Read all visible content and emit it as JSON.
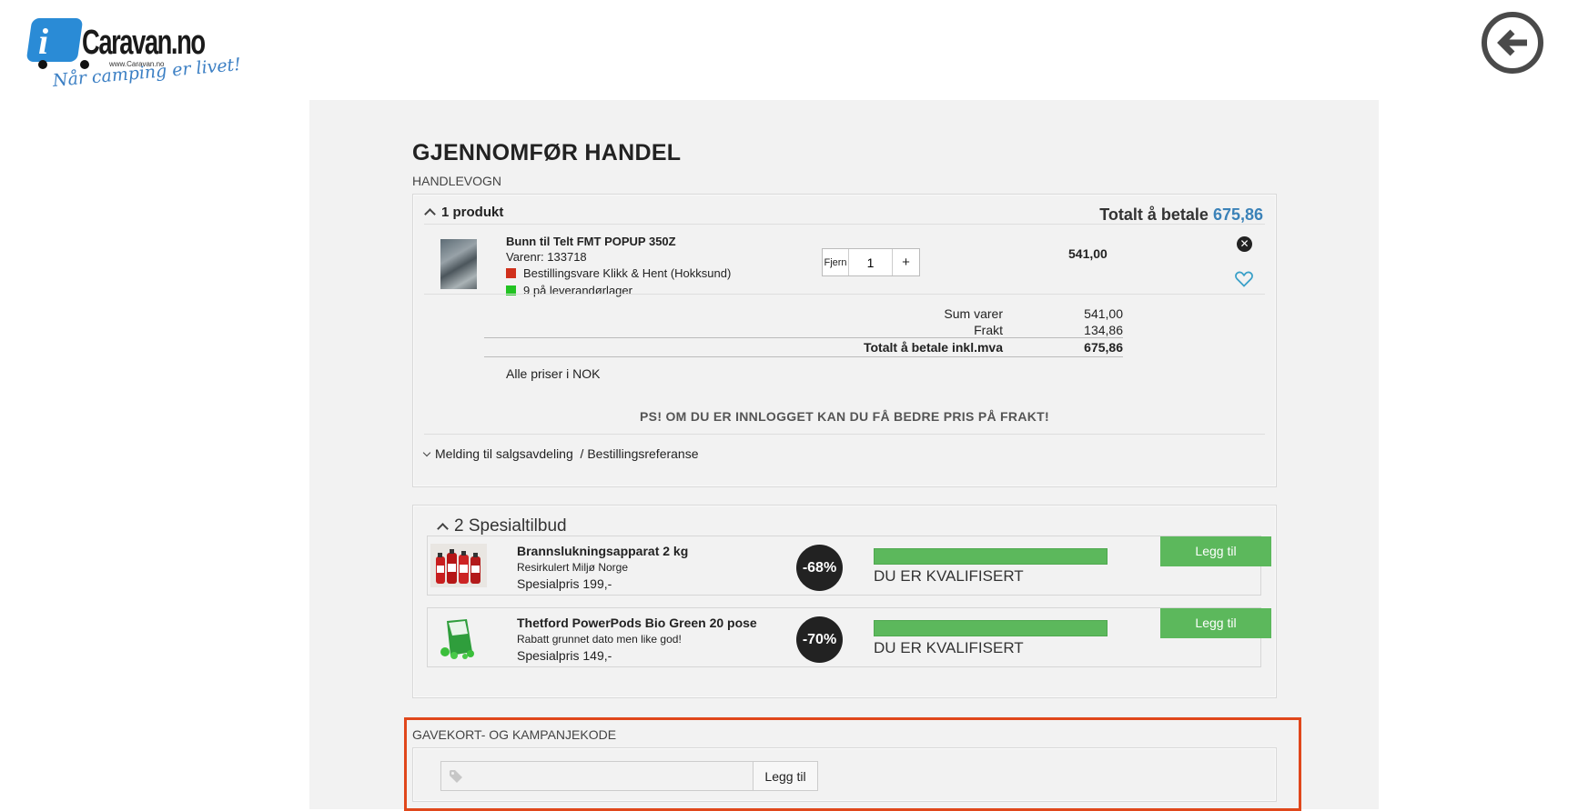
{
  "logo": {
    "brand": "Caravan.no",
    "url": "www.Caravan.no",
    "slogan": "Når camping er livet!",
    "letter": "i"
  },
  "page": {
    "title": "GJENNOMFØR HANDEL",
    "cart_label": "HANDLEVOGN",
    "currency_note": "Alle priser i NOK",
    "freight_note": "PS! OM DU ER INNLOGGET KAN DU FÅ BEDRE PRIS PÅ FRAKT!",
    "message_link_a": "Melding til salgsavdeling",
    "message_link_b": "/ Bestillingsreferanse"
  },
  "cart": {
    "count_label": "1 produkt",
    "total_label": "Totalt å betale",
    "total_value": "675,86",
    "items": [
      {
        "name": "Bunn til Telt FMT POPUP 350Z",
        "sku": "Varenr: 133718",
        "stock1": "Bestillingsvare Klikk & Hent (Hokksund)",
        "stock1_color": "#d0301c",
        "stock2": "9 på leverandørlager",
        "stock2_color": "#22c322",
        "remove_label": "Fjern",
        "quantity": "1",
        "plus_label": "+",
        "price": "541,00"
      }
    ],
    "summary": [
      {
        "label": "Sum varer",
        "value": "541,00"
      },
      {
        "label": "Frakt",
        "value": "134,86"
      },
      {
        "label": "Totalt å betale inkl.mva",
        "value": "675,86"
      }
    ]
  },
  "offers": {
    "title": "2 Spesialtilbud",
    "items": [
      {
        "name": "Brannslukningsapparat 2 kg",
        "subtitle": "Resirkulert Miljø Norge",
        "price": "Spesialpris 199,-",
        "discount": "-68%",
        "status": "DU ER KVALIFISERT",
        "progress": 1.0,
        "button": "Legg til"
      },
      {
        "name": "Thetford PowerPods Bio Green 20 pose",
        "subtitle": "Rabatt grunnet dato men like god!",
        "price": "Spesialpris 149,-",
        "discount": "-70%",
        "status": "DU ER KVALIFISERT",
        "progress": 1.0,
        "button": "Legg til"
      }
    ]
  },
  "giftcard": {
    "label": "GAVEKORT- OG KAMPANJEKODE",
    "input_value": "",
    "button": "Legg til"
  },
  "colors": {
    "accent": "#3b82b8",
    "success": "#5cb85c",
    "highlight_frame": "#e0471b"
  },
  "icons": [
    "back-arrow-icon",
    "chevron-up-icon",
    "chevron-down-icon",
    "remove-icon",
    "heart-icon",
    "tag-icon"
  ]
}
